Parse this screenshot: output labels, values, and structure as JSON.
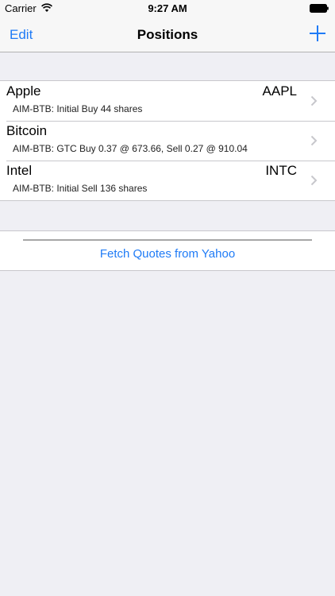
{
  "status_bar": {
    "carrier": "Carrier",
    "time": "9:27 AM"
  },
  "nav": {
    "edit_label": "Edit",
    "title": "Positions",
    "add_icon": "plus-icon"
  },
  "positions": [
    {
      "name": "Apple",
      "symbol": "AAPL",
      "detail": "AIM-BTB: Initial Buy 44 shares"
    },
    {
      "name": "Bitcoin",
      "symbol": "",
      "detail": "AIM-BTB: GTC Buy 0.37 @ 673.66, Sell 0.27 @ 910.04"
    },
    {
      "name": "Intel",
      "symbol": "INTC",
      "detail": "AIM-BTB: Initial Sell 136 shares"
    }
  ],
  "fetch": {
    "label": "Fetch Quotes from Yahoo"
  },
  "colors": {
    "accent": "#1f7bf6",
    "background": "#efeff4"
  }
}
